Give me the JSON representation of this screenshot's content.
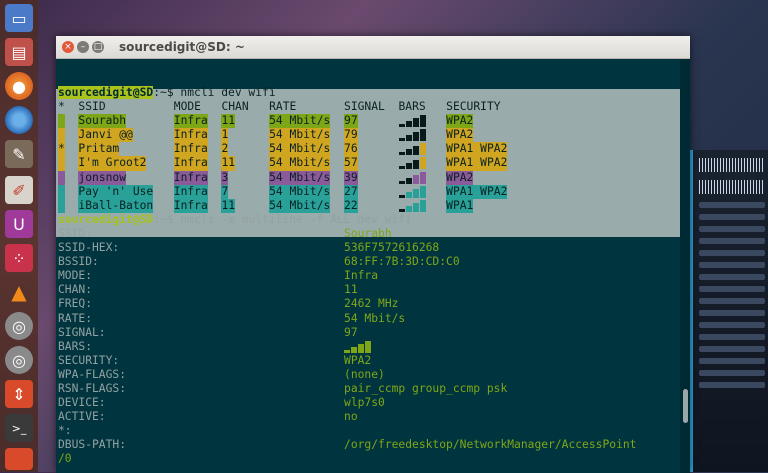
{
  "window": {
    "title": "sourcedigit@SD: ~"
  },
  "colors": {
    "terminal_bg": "#003540",
    "selection_bg": "#9aabab",
    "prompt_green": "#aac21a",
    "value_green": "#7fa616"
  },
  "launcher": {
    "icons": [
      "desktop-icon",
      "files-icon",
      "firefox-icon",
      "chromium-icon",
      "tools-icon",
      "document-icon",
      "software-center-icon",
      "dots-icon",
      "vlc-icon",
      "disk-icon",
      "disk-icon",
      "archive-icon",
      "terminal-icon",
      "photos-icon"
    ]
  },
  "terminal": {
    "prompt1": {
      "user": "sourcedigit@SD",
      "rest": ":~$ nmcli dev wifi"
    },
    "table": {
      "headers": [
        "*",
        "SSID",
        "MODE",
        "CHAN",
        "RATE",
        "SIGNAL",
        "BARS",
        "SECURITY"
      ],
      "rows": [
        {
          "active": "",
          "ssid": "Sourabh",
          "mode": "Infra",
          "chan": "11",
          "rate": "54 Mbit/s",
          "signal": "97",
          "bars": 4,
          "security": "WPA2",
          "color": "#7fa616"
        },
        {
          "active": "",
          "ssid": "Janvi @@",
          "mode": "Infra",
          "chan": "1",
          "rate": "54 Mbit/s",
          "signal": "79",
          "bars": 4,
          "security": "WPA2",
          "color": "#d0a520"
        },
        {
          "active": "*",
          "ssid": "Pritam",
          "mode": "Infra",
          "chan": "2",
          "rate": "54 Mbit/s",
          "signal": "76",
          "bars": 3,
          "security": "WPA1 WPA2",
          "color": "#d0a520"
        },
        {
          "active": "",
          "ssid": "I'm Groot2",
          "mode": "Infra",
          "chan": "11",
          "rate": "54 Mbit/s",
          "signal": "57",
          "bars": 3,
          "security": "WPA1 WPA2",
          "color": "#d0a520"
        },
        {
          "active": "",
          "ssid": "jonsnow",
          "mode": "Infra",
          "chan": "3",
          "rate": "54 Mbit/s",
          "signal": "39",
          "bars": 2,
          "security": "WPA2",
          "color": "#8a5a9a"
        },
        {
          "active": "",
          "ssid": "Pay 'n' Use",
          "mode": "Infra",
          "chan": "7",
          "rate": "54 Mbit/s",
          "signal": "27",
          "bars": 1,
          "security": "WPA1 WPA2",
          "color": "#2aa198"
        },
        {
          "active": "",
          "ssid": "iBall-Baton",
          "mode": "Infra",
          "chan": "11",
          "rate": "54 Mbit/s",
          "signal": "22",
          "bars": 1,
          "security": "WPA1",
          "color": "#2aa198"
        }
      ]
    },
    "prompt2": {
      "user": "sourcedigit@SD",
      "rest": ":~$ nmcli -m multiline -f ALL dev wifi"
    },
    "details": [
      {
        "key": "SSID:",
        "value": "Sourabh"
      },
      {
        "key": "SSID-HEX:",
        "value": "536F7572616268"
      },
      {
        "key": "BSSID:",
        "value": "68:FF:7B:3D:CD:C0"
      },
      {
        "key": "MODE:",
        "value": "Infra"
      },
      {
        "key": "CHAN:",
        "value": "11"
      },
      {
        "key": "FREQ:",
        "value": "2462 MHz"
      },
      {
        "key": "RATE:",
        "value": "54 Mbit/s"
      },
      {
        "key": "SIGNAL:",
        "value": "97"
      },
      {
        "key": "BARS:",
        "value": ""
      },
      {
        "key": "SECURITY:",
        "value": "WPA2"
      },
      {
        "key": "WPA-FLAGS:",
        "value": "(none)"
      },
      {
        "key": "RSN-FLAGS:",
        "value": "pair_ccmp group_ccmp psk"
      },
      {
        "key": "DEVICE:",
        "value": "wlp7s0"
      },
      {
        "key": "ACTIVE:",
        "value": "no"
      },
      {
        "key": "*:",
        "value": ""
      },
      {
        "key": "DBUS-PATH:",
        "value": "/org/freedesktop/NetworkManager/AccessPoint"
      }
    ],
    "wrap_line": "/0"
  }
}
